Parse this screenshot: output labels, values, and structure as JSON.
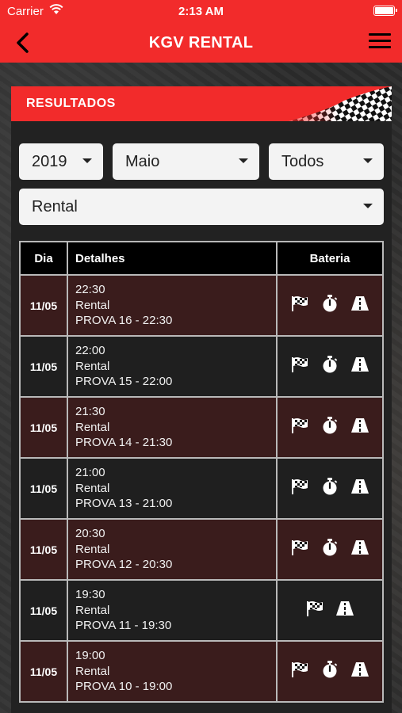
{
  "status_bar": {
    "carrier": "Carrier",
    "time": "2:13 AM"
  },
  "nav": {
    "title": "KGV RENTAL"
  },
  "card": {
    "title": "RESULTADOS"
  },
  "filters": {
    "year": "2019",
    "month": "Maio",
    "category": "Todos",
    "type": "Rental"
  },
  "table": {
    "headers": {
      "day": "Dia",
      "details": "Detalhes",
      "battery": "Bateria"
    },
    "rows": [
      {
        "day": "11/05",
        "time": "22:30",
        "type": "Rental",
        "race": "PROVA 16 - 22:30",
        "icons": [
          "checkered-flag-icon",
          "stopwatch-icon",
          "track-icon"
        ]
      },
      {
        "day": "11/05",
        "time": "22:00",
        "type": "Rental",
        "race": "PROVA 15 - 22:00",
        "icons": [
          "checkered-flag-icon",
          "stopwatch-icon",
          "track-icon"
        ]
      },
      {
        "day": "11/05",
        "time": "21:30",
        "type": "Rental",
        "race": "PROVA 14 - 21:30",
        "icons": [
          "checkered-flag-icon",
          "stopwatch-icon",
          "track-icon"
        ]
      },
      {
        "day": "11/05",
        "time": "21:00",
        "type": "Rental",
        "race": "PROVA 13 - 21:00",
        "icons": [
          "checkered-flag-icon",
          "stopwatch-icon",
          "track-icon"
        ]
      },
      {
        "day": "11/05",
        "time": "20:30",
        "type": "Rental",
        "race": "PROVA 12 - 20:30",
        "icons": [
          "checkered-flag-icon",
          "stopwatch-icon",
          "track-icon"
        ]
      },
      {
        "day": "11/05",
        "time": "19:30",
        "type": "Rental",
        "race": "PROVA 11 - 19:30",
        "icons": [
          "checkered-flag-icon",
          "track-icon"
        ]
      },
      {
        "day": "11/05",
        "time": "19:00",
        "type": "Rental",
        "race": "PROVA 10 - 19:00",
        "icons": [
          "checkered-flag-icon",
          "stopwatch-icon",
          "track-icon"
        ]
      }
    ]
  },
  "colors": {
    "accent": "#f22b2b",
    "row_dark": "#3a1c1c",
    "row_light": "#1f1f1f"
  }
}
